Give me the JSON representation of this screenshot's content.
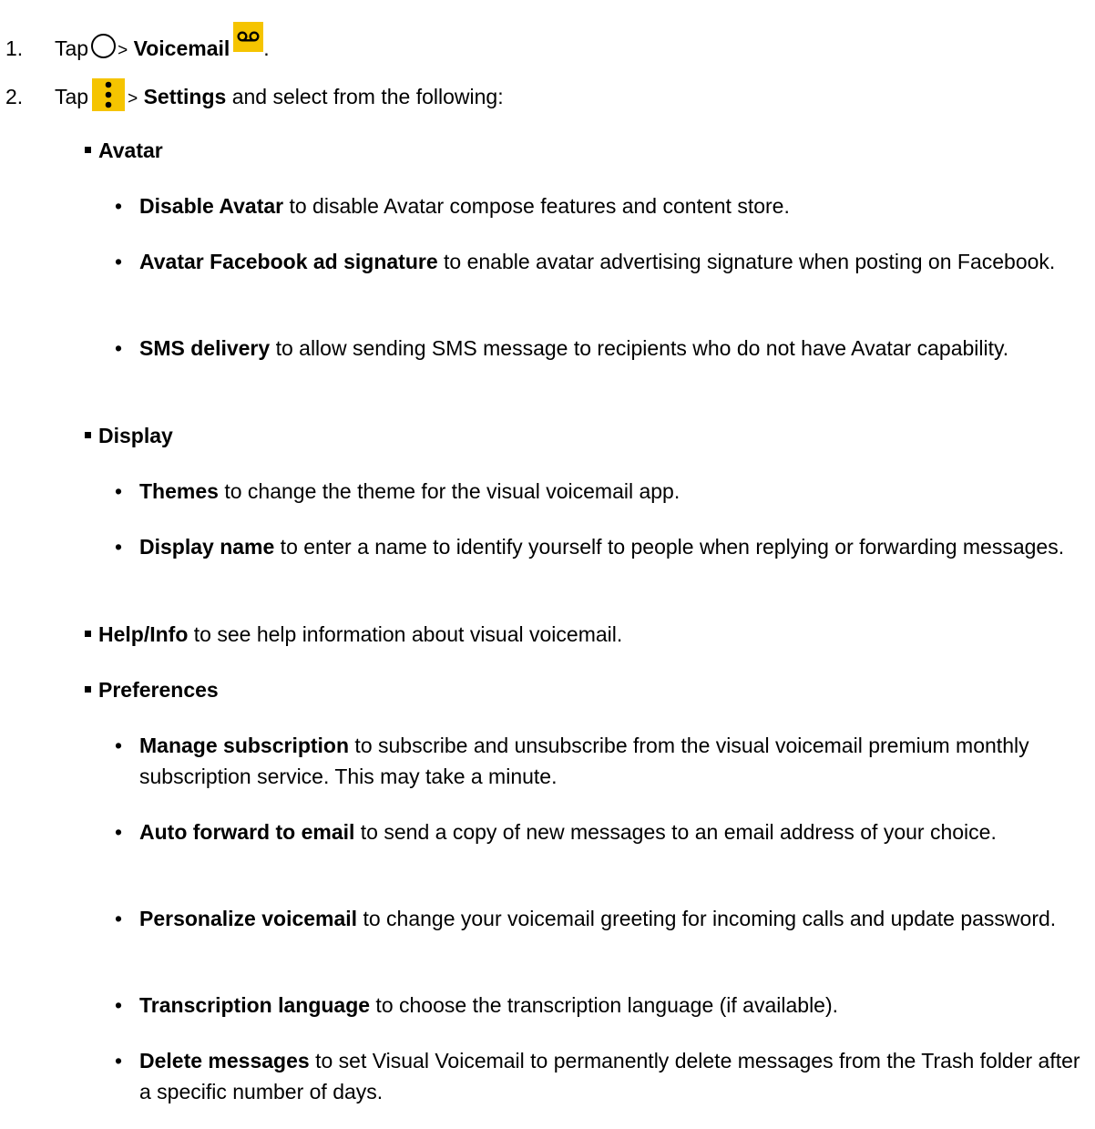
{
  "steps": [
    {
      "number": "1.",
      "tap": "Tap",
      "sep": ">",
      "target": "Voicemail",
      "end": ".",
      "icon_before": "home-circle-icon",
      "icon_after": "voicemail-icon"
    },
    {
      "number": "2.",
      "tap": "Tap",
      "sep": ">",
      "target": "Settings",
      "rest": " and select from the following:",
      "icon_before": "more-options-icon"
    }
  ],
  "colors": {
    "icon_yellow": "#f5c400",
    "text": "#000000"
  },
  "sections": [
    {
      "title": "Avatar",
      "items": [
        {
          "term": "Disable Avatar",
          "desc": " to disable Avatar compose features and content store."
        },
        {
          "term": "Avatar Facebook ad signature",
          "desc": " to enable avatar advertising signature when posting on Facebook."
        },
        {
          "term": "SMS delivery",
          "desc": " to allow sending SMS message to recipients who do not have Avatar capability."
        }
      ]
    },
    {
      "title": "Display",
      "items": [
        {
          "term": "Themes",
          "desc": " to change the theme for the visual voicemail app."
        },
        {
          "term": "Display name",
          "desc": " to enter a name to identify yourself to people when replying or forwarding messages."
        }
      ]
    },
    {
      "title": "Help/Info",
      "title_desc": " to see help information about visual voicemail."
    },
    {
      "title": "Preferences",
      "items": [
        {
          "term": "Manage subscription",
          "desc": " to subscribe and unsubscribe from the visual voicemail premium monthly subscription service. This may take a minute."
        },
        {
          "term": "Auto forward to email",
          "desc": " to send a copy of new messages to an email address of your choice."
        },
        {
          "term": "Personalize voicemail",
          "desc": " to change your voicemail greeting for incoming calls and update password."
        },
        {
          "term": "Transcription language",
          "desc": " to choose the transcription language (if available)."
        },
        {
          "term": "Delete messages",
          "desc": " to set Visual Voicemail to permanently delete messages from the Trash folder after a specific number of days."
        }
      ]
    }
  ]
}
